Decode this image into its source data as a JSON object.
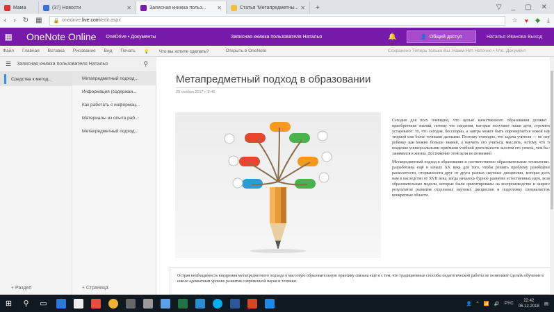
{
  "browser": {
    "tabs": [
      {
        "label": "Мама",
        "color": "#d33",
        "active": false,
        "closable": false
      },
      {
        "label": "(37) Новости",
        "color": "#3a6fd8",
        "active": false,
        "closable": true
      },
      {
        "label": "Записная книжка польз...",
        "color": "#7719aa",
        "active": true,
        "closable": true
      },
      {
        "label": "Статья 'Метапредметны...",
        "color": "#f0c040",
        "active": false,
        "closable": true
      }
    ],
    "new_tab": "+",
    "url_prefix": "onedrive.",
    "url_host": "live.com",
    "url_path": "/edit.aspx",
    "window_controls": [
      "▽",
      "_",
      "▢",
      "✕"
    ]
  },
  "app": {
    "name": "OneNote Online",
    "breadcrumb": "OneDrive • Документы",
    "notebook_title": "Записная книжка пользователя Наталья",
    "share_label": "Общий доступ",
    "user_name": "Наталья Иванова   Выход"
  },
  "ribbon": {
    "items": [
      "Файл",
      "Главная",
      "Вставка",
      "Рисование",
      "Вид",
      "Печать"
    ],
    "tell_me": "Что вы хотите сделать?",
    "open_in_onenote": "Открыть в OneNote",
    "status": "Сохранено   Теперь только Вы. Нажм Нет Неточно • Что. Документ"
  },
  "notebook": {
    "title": "Записная книжка пользователя Наталья",
    "sections": [
      {
        "label": "Средства к метод...",
        "active": true
      }
    ],
    "pages": [
      {
        "label": "Метапредметный подход...",
        "active": true
      },
      {
        "label": "Информация (содержан...",
        "active": false
      },
      {
        "label": "Как работать с информац...",
        "active": false
      },
      {
        "label": "Материалы из опыта раб...",
        "active": false
      },
      {
        "label": "Метапредметный подход...",
        "active": false
      }
    ],
    "add_section": "+ Раздел",
    "add_page": "+ Страница"
  },
  "page": {
    "title": "Метапредметный подход в образовании",
    "date": "29 ноября 2017 г.   9:46",
    "paragraphs": [
      "Сегодня для всех очевидно, что целью качественного образования должно быть приобретение знаний, потому что сведения, которые получают наши дети, стремительно устаревают: то, что сегодня, бесспорно, а завтра может быть опровергается новой научной теорией или более точными данными. Поэтому очевидно, что задача учителя — не передать ребенку как можно больше знаний, а научить его учиться, мыслить, потому что только владение универсальными приёмами учебной деятельности залогом его успеха, чем бы он не занимался в жизни. Достижение этой цели во возможно",
      "Метапредметный подход в образовании и соответственно образовательные технологии были разработаны ещё в начале XX века для того, чтобы решить проблему разобщённости, расколотости, оторванности друг от друга разных научных дисциплин, которая досталась нам в наследство от XVII века, когда началось бурное развитие естественных наук, возникли образовательные модели, которые были ориентированы на воспроизводство и закрепление результатов развития отдельных научных дисциплин и подготовку специалистов под конкретные области."
    ],
    "link_word": "расколотости",
    "note": "Острая необходимость внедрения метапредметного подхода в массовую образовательную практику связана ещё и с тем, что традиционные способы педагогической работы не позволяют сделать обучение в школе адекватным уровню развития современной науки и техники."
  },
  "illustration": {
    "colors": [
      "#e8452f",
      "#f39a1e",
      "#49b24a",
      "#e8452f",
      "#f39a1e",
      "#2e9bd6",
      "#49b24a"
    ]
  },
  "taskbar": {
    "tray_text": "РУС",
    "time": "22:42",
    "date": "06.12.2018"
  }
}
